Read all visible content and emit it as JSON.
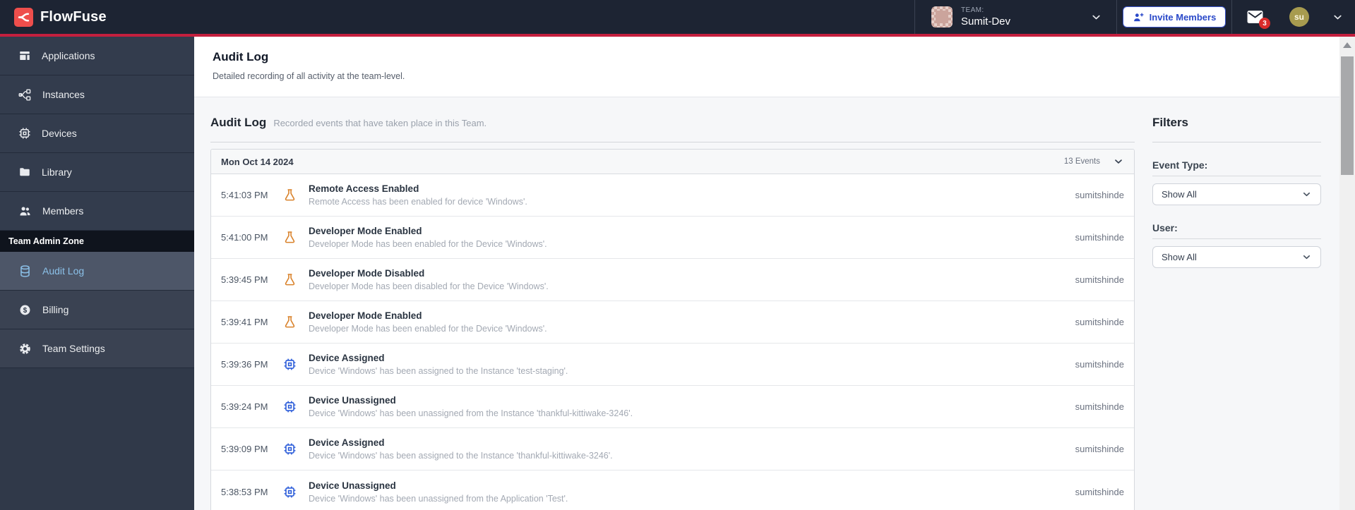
{
  "colors": {
    "navbar_bg": "#1d2433",
    "accent_red_line": "#c41f3e",
    "brand_red": "#ee4e4c",
    "sidebar_bg": "#303949",
    "sidebar_active_text": "#8bc0e8",
    "badge_red": "#d92b2b",
    "flask_icon_orange": "#d9822b",
    "chip_icon_blue": "#2b5cd9",
    "invite_blue": "#2a49c9"
  },
  "brand": {
    "name": "FlowFuse",
    "logo_icon": "flowfuse-fork-icon"
  },
  "navbar": {
    "team_label": "TEAM:",
    "team_name": "Sumit-Dev",
    "team_avatar_icon": "team-identicon",
    "invite_label": "Invite Members",
    "invite_icon": "user-plus-icon",
    "mail_icon": "mail-icon",
    "mail_badge": "3",
    "user_initials": "su",
    "caret_icon": "chevron-down-icon"
  },
  "sidebar": {
    "items": [
      {
        "label": "Applications",
        "icon": "applications-icon"
      },
      {
        "label": "Instances",
        "icon": "instances-icon"
      },
      {
        "label": "Devices",
        "icon": "devices-icon"
      },
      {
        "label": "Library",
        "icon": "library-icon"
      },
      {
        "label": "Members",
        "icon": "members-icon"
      }
    ],
    "admin_zone_label": "Team Admin Zone",
    "admin_items": [
      {
        "label": "Audit Log",
        "icon": "audit-log-icon",
        "active": true
      },
      {
        "label": "Billing",
        "icon": "billing-icon",
        "active": false
      },
      {
        "label": "Team Settings",
        "icon": "gear-icon",
        "active": false
      }
    ]
  },
  "page_header": {
    "title": "Audit Log",
    "subtitle": "Detailed recording of all activity at the team-level."
  },
  "main": {
    "section_title": "Audit Log",
    "section_subtitle": "Recorded events that have taken place in this Team.",
    "group": {
      "date": "Mon Oct 14 2024",
      "count": "13 Events",
      "collapse_icon": "chevron-down-icon"
    },
    "events": [
      {
        "time": "5:41:03 PM",
        "icon": "flask-icon",
        "title": "Remote Access Enabled",
        "description": "Remote Access has been enabled for device 'Windows'.",
        "user": "sumitshinde"
      },
      {
        "time": "5:41:00 PM",
        "icon": "flask-icon",
        "title": "Developer Mode Enabled",
        "description": "Developer Mode has been enabled for the Device 'Windows'.",
        "user": "sumitshinde"
      },
      {
        "time": "5:39:45 PM",
        "icon": "flask-icon",
        "title": "Developer Mode Disabled",
        "description": "Developer Mode has been disabled for the Device 'Windows'.",
        "user": "sumitshinde"
      },
      {
        "time": "5:39:41 PM",
        "icon": "flask-icon",
        "title": "Developer Mode Enabled",
        "description": "Developer Mode has been enabled for the Device 'Windows'.",
        "user": "sumitshinde"
      },
      {
        "time": "5:39:36 PM",
        "icon": "chip-icon",
        "title": "Device Assigned",
        "description": "Device 'Windows' has been assigned to the Instance 'test-staging'.",
        "user": "sumitshinde"
      },
      {
        "time": "5:39:24 PM",
        "icon": "chip-icon",
        "title": "Device Unassigned",
        "description": "Device 'Windows' has been unassigned from the Instance 'thankful-kittiwake-3246'.",
        "user": "sumitshinde"
      },
      {
        "time": "5:39:09 PM",
        "icon": "chip-icon",
        "title": "Device Assigned",
        "description": "Device 'Windows' has been assigned to the Instance 'thankful-kittiwake-3246'.",
        "user": "sumitshinde"
      },
      {
        "time": "5:38:53 PM",
        "icon": "chip-icon",
        "title": "Device Unassigned",
        "description": "Device 'Windows' has been unassigned from the Application 'Test'.",
        "user": "sumitshinde"
      }
    ]
  },
  "filters": {
    "title": "Filters",
    "event_type": {
      "label": "Event Type:",
      "value": "Show All"
    },
    "user": {
      "label": "User:",
      "value": "Show All"
    }
  }
}
